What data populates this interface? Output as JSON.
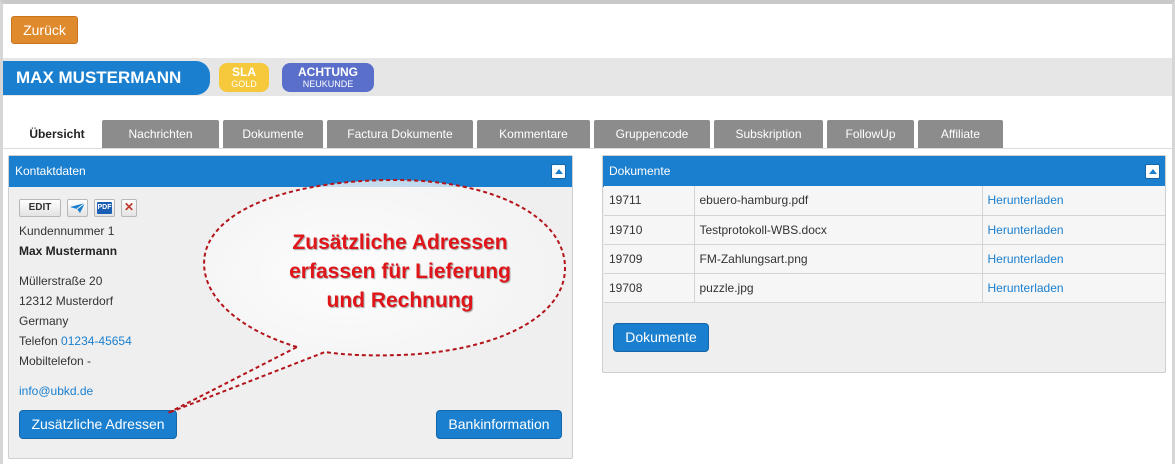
{
  "back_button": "Zurück",
  "customer": {
    "name": "MAX MUSTERMANN",
    "badges": [
      {
        "title": "SLA",
        "sub": "GOLD",
        "color": "#f5c93b"
      },
      {
        "title": "ACHTUNG",
        "sub": "NEUKUNDE",
        "color": "#5a6fc9"
      }
    ]
  },
  "tabs": [
    "Übersicht",
    "Nachrichten",
    "Dokumente",
    "Factura Dokumente",
    "Kommentare",
    "Gruppencode",
    "Subskription",
    "FollowUp",
    "Affiliate"
  ],
  "active_tab": "Übersicht",
  "contact": {
    "title": "Kontaktdaten",
    "actions": {
      "edit": "EDIT",
      "send_icon": "send-icon",
      "pdf": "PDF",
      "delete_icon": "close-icon"
    },
    "customer_number": "Kundennummer 1",
    "name": "Max Mustermann",
    "street": "Müllerstraße 20",
    "city": "12312 Musterdorf",
    "country": "Germany",
    "phone_label": "Telefon",
    "phone": "01234-45654",
    "mobile_label": "Mobiltelefon -",
    "email": "info@ubkd.de",
    "additional_addresses_button": "Zusätzliche Adressen",
    "bank_button": "Bankinformation"
  },
  "documents": {
    "title": "Dokumente",
    "rows": [
      {
        "id": "19711",
        "file": "ebuero-hamburg.pdf",
        "action": "Herunterladen"
      },
      {
        "id": "19710",
        "file": "Testprotokoll-WBS.docx",
        "action": "Herunterladen"
      },
      {
        "id": "19709",
        "file": "FM-Zahlungsart.png",
        "action": "Herunterladen"
      },
      {
        "id": "19708",
        "file": "puzzle.jpg",
        "action": "Herunterladen"
      }
    ],
    "button": "Dokumente"
  },
  "callout": {
    "line1": "Zusätzliche Adressen",
    "line2": "erfassen für Lieferung",
    "line3": "und Rechnung",
    "color": "#e0151a"
  }
}
